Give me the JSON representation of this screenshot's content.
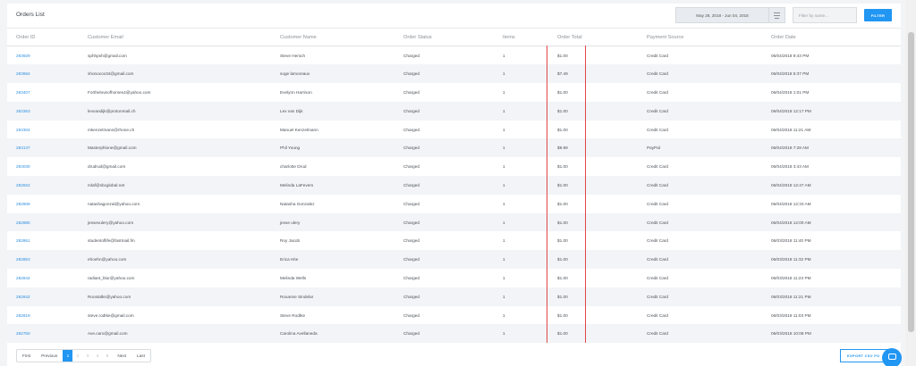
{
  "header": {
    "title": "Orders List",
    "date_range": "May 28, 2018  -  Jun 04, 2018",
    "search_placeholder": "Filter by name...",
    "filter_label": "FILTER"
  },
  "table": {
    "columns": [
      "Order ID",
      "Customer Email",
      "Customer Name",
      "Order Status",
      "Items",
      "Order Total",
      "Payment Source",
      "Order Date"
    ],
    "rows": [
      [
        "283929",
        "sphhpsh@gmail.com",
        "Steve Hersch",
        "Charged",
        "1",
        "$1.00",
        "Credit Card",
        "06/04/2018 9:43 PM"
      ],
      [
        "283694",
        "shonocox34@gmail.com",
        "soge lamoreaux",
        "Charged",
        "1",
        "$7.49",
        "Credit Card",
        "06/04/2018 5:37 PM"
      ],
      [
        "283407",
        "Fortheloveofhorses4@yahoo.com",
        "Evelynn Harrison",
        "Charged",
        "1",
        "$1.00",
        "Credit Card",
        "06/04/2018 1:01 PM"
      ],
      [
        "283363",
        "lexvandijk@protonmail.ch",
        "Lex van Dijk",
        "Charged",
        "1",
        "$1.00",
        "Credit Card",
        "06/04/2018 12:17 PM"
      ],
      [
        "283304",
        "mkenzelmann@rhone.ch",
        "Manuel Kenzelmann",
        "Charged",
        "1",
        "$1.00",
        "Credit Card",
        "06/04/2018 11:21 AM"
      ],
      [
        "283137",
        "Masterphlone@gmail.com",
        "Phil Young",
        "Charged",
        "1",
        "$9.99",
        "PayPal",
        "06/04/2018 7:28 AM"
      ],
      [
        "283030",
        "drudrud@gmail.com",
        "charlotte Drud",
        "Charged",
        "1",
        "$1.00",
        "Credit Card",
        "06/04/2018 3:43 AM"
      ],
      [
        "282922",
        "mlaf@sbcglobal.net",
        "Melinda LaFevers",
        "Charged",
        "1",
        "$1.00",
        "Credit Card",
        "06/04/2018 12:47 AM"
      ],
      [
        "282909",
        "natashagonzal@yahoo.com",
        "Natasha Gonzalez",
        "Charged",
        "1",
        "$1.00",
        "Credit Card",
        "06/04/2018 12:33 AM"
      ],
      [
        "282880",
        "jessevulery@yahoo.com",
        "jesse ulery",
        "Charged",
        "1",
        "$1.00",
        "Credit Card",
        "06/04/2018 12:00 AM"
      ],
      [
        "282861",
        "studentoflife@fastmail.fm",
        "Roy Jacob",
        "Charged",
        "1",
        "$1.00",
        "Credit Card",
        "06/03/2018 11:40 PM"
      ],
      [
        "282853",
        "ehoehn@yahoo.com",
        "Erica Hite",
        "Charged",
        "1",
        "$1.00",
        "Credit Card",
        "06/03/2018 11:32 PM"
      ],
      [
        "282844",
        "radiant_blur@yahoo.com",
        "Melinda Wells",
        "Charged",
        "1",
        "$1.00",
        "Credit Card",
        "06/03/2018 11:23 PM"
      ],
      [
        "282842",
        "Roostalks@yahoo.com",
        "Roxanne Sindelar",
        "Charged",
        "1",
        "$1.00",
        "Credit Card",
        "06/03/2018 11:21 PM"
      ],
      [
        "282819",
        "steve.rodtke@gmail.com",
        "Steve Rodtke",
        "Charged",
        "1",
        "$1.00",
        "Credit Card",
        "06/03/2018 11:03 PM"
      ],
      [
        "282750",
        "Ave.caro@gmail.com",
        "Carolina Avellaneda",
        "Charged",
        "1",
        "$1.00",
        "Credit Card",
        "06/03/2018 10:08 PM"
      ]
    ]
  },
  "pagination": {
    "first": "First",
    "previous": "Previous",
    "pages": [
      "1",
      "2",
      "3",
      "4",
      "5"
    ],
    "next": "Next",
    "last": "Last"
  },
  "export_label": "EXPORT CSV FO",
  "colors": {
    "accent": "#2196f3",
    "link": "#2f8fe0",
    "highlight_line": "#e0474c"
  },
  "icons": [
    "filter-lines-icon",
    "chat-icon"
  ]
}
